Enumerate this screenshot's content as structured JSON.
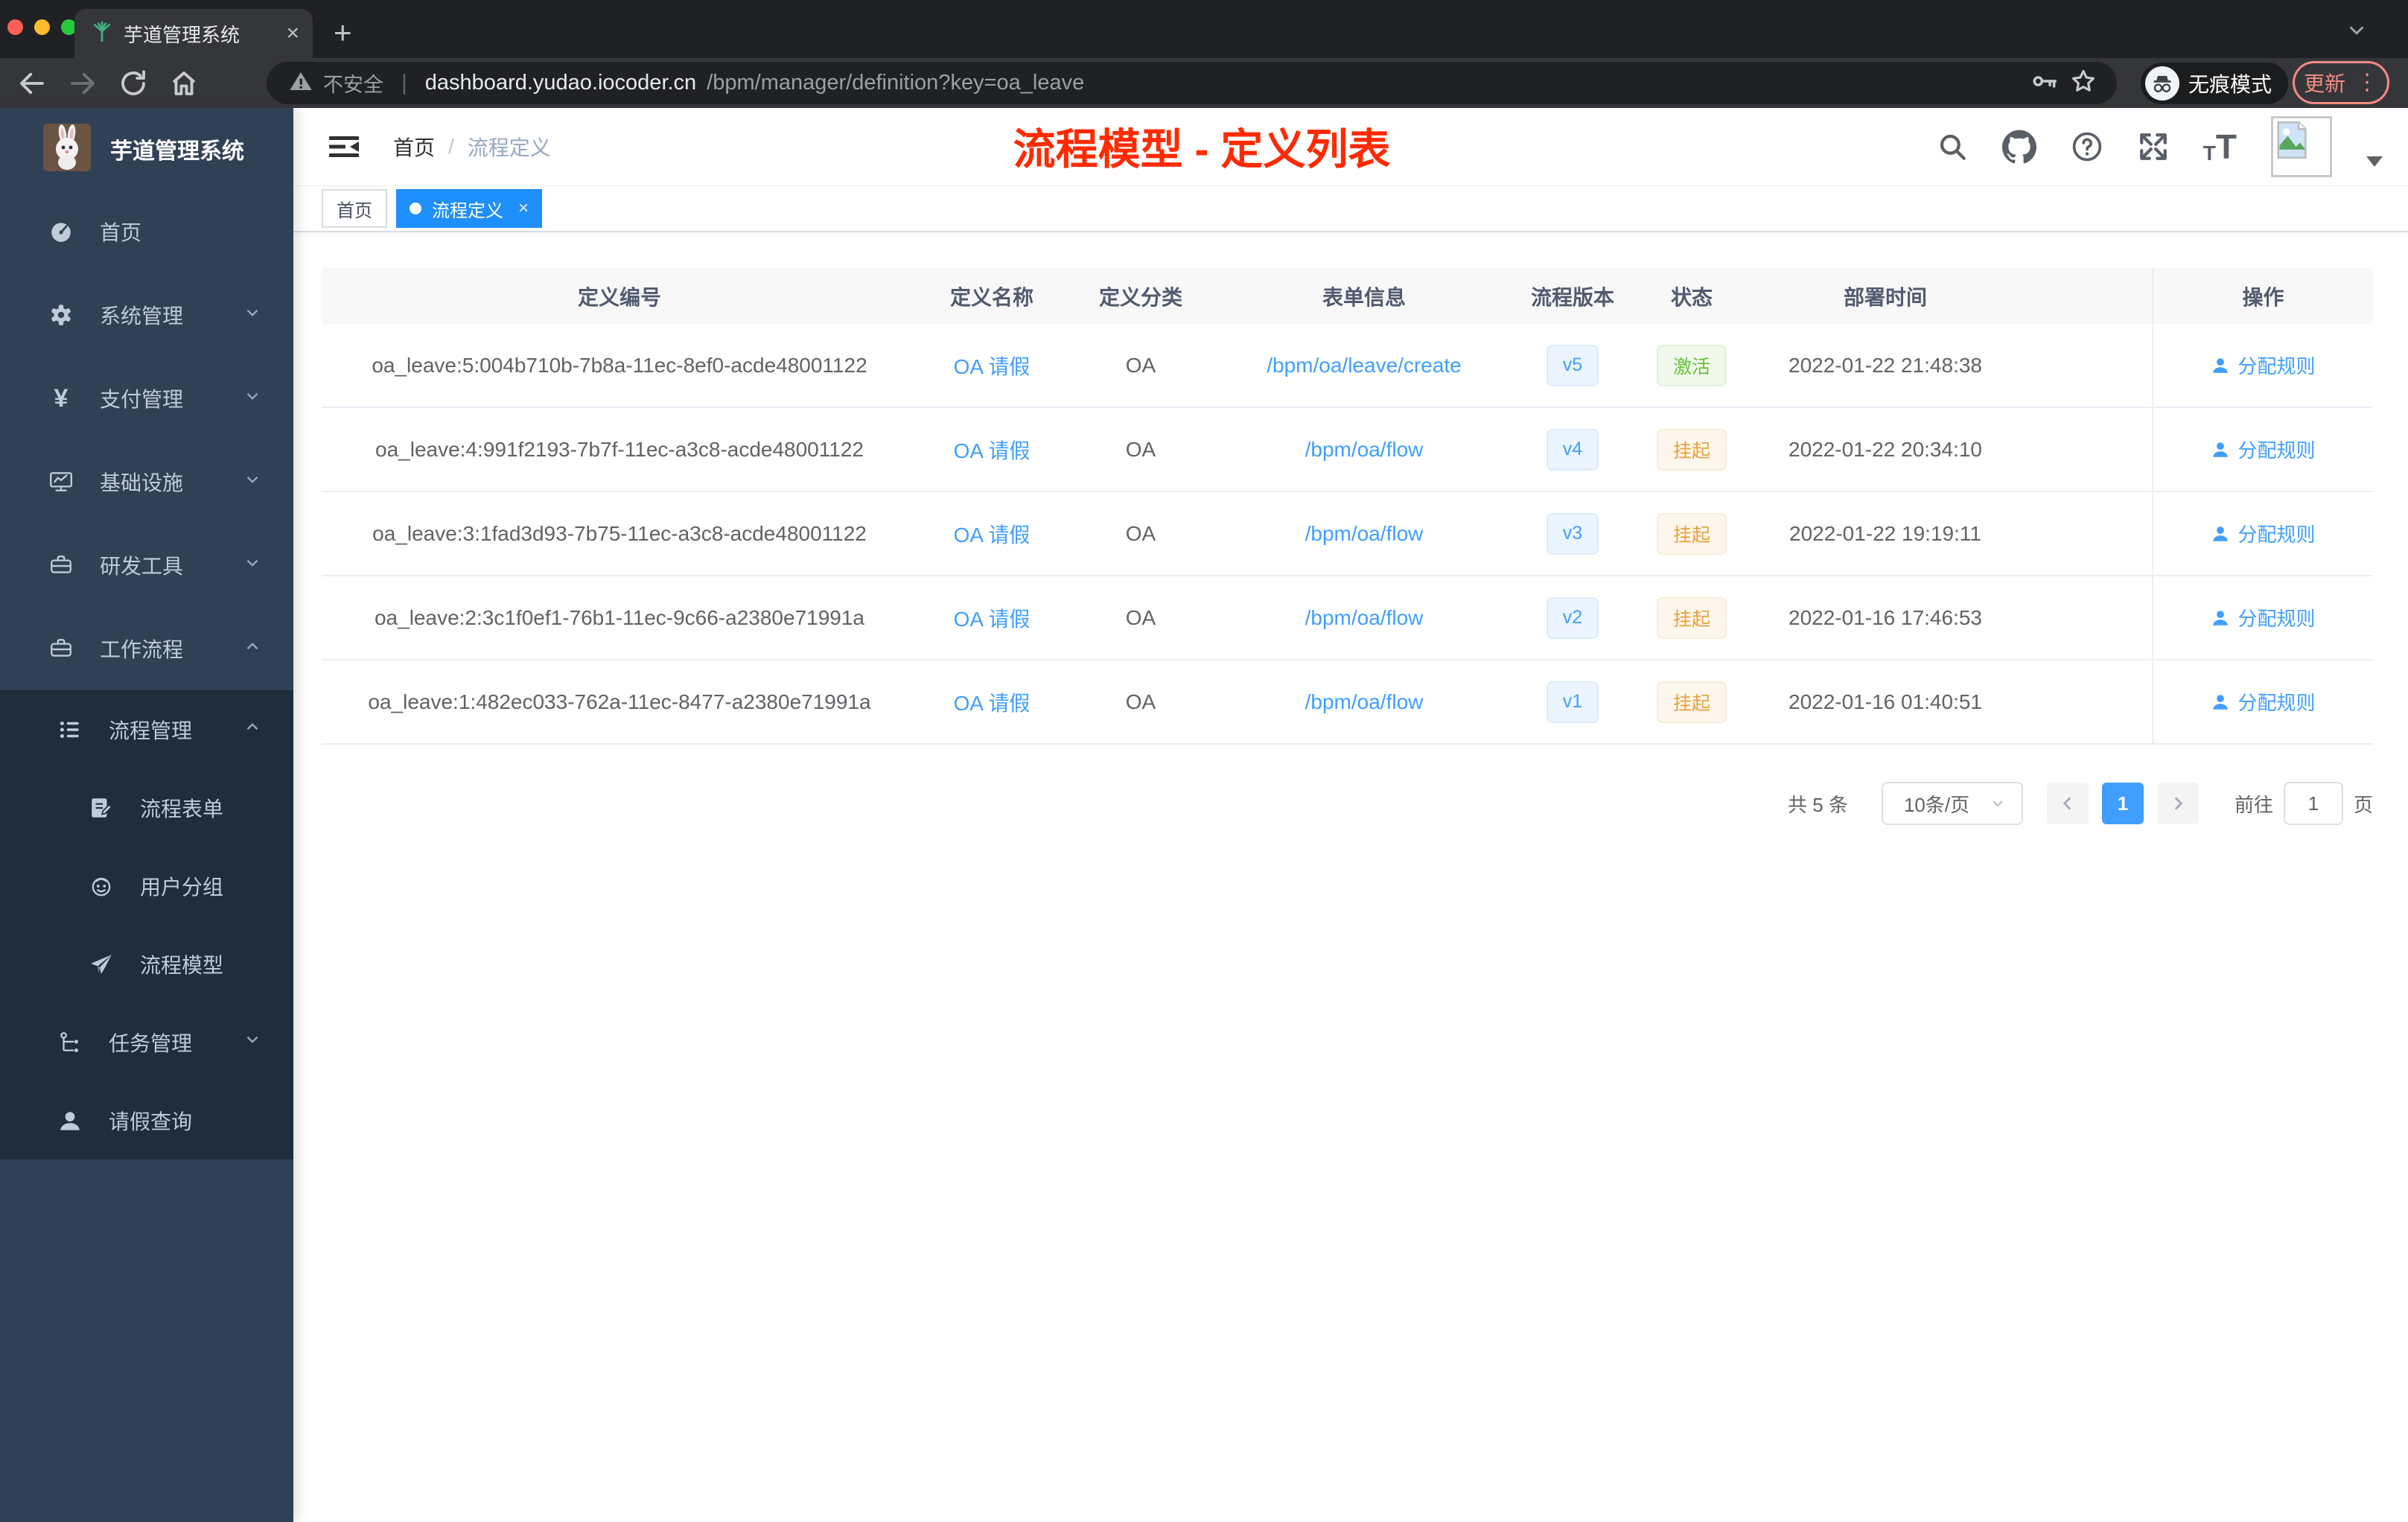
{
  "browser": {
    "tab_title": "芋道管理系统",
    "security_label": "不安全",
    "url_host": "dashboard.yudao.iocoder.cn",
    "url_path": "/bpm/manager/definition?key=oa_leave",
    "incognito_label": "无痕模式",
    "update_label": "更新"
  },
  "sidebar": {
    "logo_title": "芋道管理系统",
    "items": [
      {
        "label": "首页"
      },
      {
        "label": "系统管理"
      },
      {
        "label": "支付管理"
      },
      {
        "label": "基础设施"
      },
      {
        "label": "研发工具"
      },
      {
        "label": "工作流程"
      },
      {
        "label": "流程管理"
      },
      {
        "label": "流程表单"
      },
      {
        "label": "用户分组"
      },
      {
        "label": "流程模型"
      },
      {
        "label": "任务管理"
      },
      {
        "label": "请假查询"
      }
    ]
  },
  "header": {
    "breadcrumb_home": "首页",
    "breadcrumb_sep": "/",
    "breadcrumb_current": "流程定义",
    "annotation": "流程模型 - 定义列表"
  },
  "tags": {
    "home": "首页",
    "active": "流程定义"
  },
  "table": {
    "columns": [
      "定义编号",
      "定义名称",
      "定义分类",
      "表单信息",
      "流程版本",
      "状态",
      "部署时间",
      "操作"
    ],
    "rows": [
      {
        "id": "oa_leave:5:004b710b-7b8a-11ec-8ef0-acde48001122",
        "name": "OA 请假",
        "category": "OA",
        "form": "/bpm/oa/leave/create",
        "version": "v5",
        "status": "激活",
        "time": "2022-01-22 21:48:38",
        "action": "分配规则"
      },
      {
        "id": "oa_leave:4:991f2193-7b7f-11ec-a3c8-acde48001122",
        "name": "OA 请假",
        "category": "OA",
        "form": "/bpm/oa/flow",
        "version": "v4",
        "status": "挂起",
        "time": "2022-01-22 20:34:10",
        "action": "分配规则"
      },
      {
        "id": "oa_leave:3:1fad3d93-7b75-11ec-a3c8-acde48001122",
        "name": "OA 请假",
        "category": "OA",
        "form": "/bpm/oa/flow",
        "version": "v3",
        "status": "挂起",
        "time": "2022-01-22 19:19:11",
        "action": "分配规则"
      },
      {
        "id": "oa_leave:2:3c1f0ef1-76b1-11ec-9c66-a2380e71991a",
        "name": "OA 请假",
        "category": "OA",
        "form": "/bpm/oa/flow",
        "version": "v2",
        "status": "挂起",
        "time": "2022-01-16 17:46:53",
        "action": "分配规则"
      },
      {
        "id": "oa_leave:1:482ec033-762a-11ec-8477-a2380e71991a",
        "name": "OA 请假",
        "category": "OA",
        "form": "/bpm/oa/flow",
        "version": "v1",
        "status": "挂起",
        "time": "2022-01-16 01:40:51",
        "action": "分配规则"
      }
    ]
  },
  "pagination": {
    "total": "共 5 条",
    "page_size": "10条/页",
    "page": "1",
    "goto": "前往",
    "goto_value": "1",
    "unit": "页"
  },
  "colors": {
    "accent": "#409eff",
    "tag_active": "#1f8ffb",
    "annotation_red": "#ff2a00",
    "status_active": "#67c23a",
    "status_suspended": "#e6a23c",
    "sidebar_bg": "#304156",
    "submenu_bg": "#1f2d3d"
  }
}
